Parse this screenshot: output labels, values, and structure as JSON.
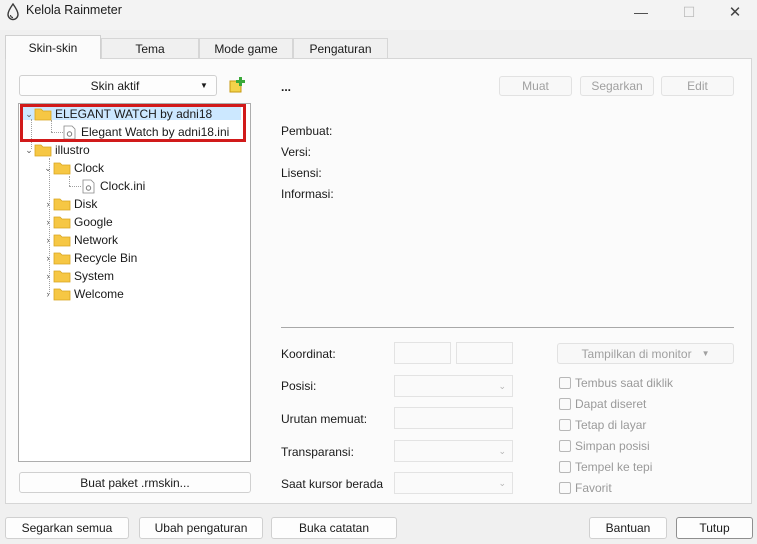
{
  "window": {
    "title": "Kelola Rainmeter",
    "icon": "rainmeter-drop-icon",
    "controls": [
      "minimize-icon",
      "maximize-icon",
      "close-icon"
    ]
  },
  "tabs": [
    {
      "label": "Skin-skin",
      "active": true
    },
    {
      "label": "Tema",
      "active": false
    },
    {
      "label": "Mode game",
      "active": false
    },
    {
      "label": "Pengaturan",
      "active": false
    }
  ],
  "skins_panel": {
    "dropdown_value": "Skin aktif",
    "add_icon": "add-skin-icon",
    "tree": [
      {
        "label": "ELEGANT WATCH by adni18",
        "type": "folder",
        "expanded": true,
        "selected": true
      },
      {
        "label": "Elegant Watch by adni18.ini",
        "type": "file"
      },
      {
        "label": "illustro",
        "type": "folder",
        "expanded": true
      },
      {
        "label": "Clock",
        "type": "folder",
        "expanded": true
      },
      {
        "label": "Clock.ini",
        "type": "file"
      },
      {
        "label": "Disk",
        "type": "folder",
        "expanded": false
      },
      {
        "label": "Google",
        "type": "folder",
        "expanded": false
      },
      {
        "label": "Network",
        "type": "folder",
        "expanded": false
      },
      {
        "label": "Recycle Bin",
        "type": "folder",
        "expanded": false
      },
      {
        "label": "System",
        "type": "folder",
        "expanded": false
      },
      {
        "label": "Welcome",
        "type": "folder",
        "expanded": false
      }
    ],
    "create_package_label": "Buat paket .rmskin..."
  },
  "details": {
    "skin_name": "...",
    "buttons": {
      "load": "Muat",
      "refresh": "Segarkan",
      "edit": "Edit"
    },
    "labels": {
      "author": "Pembuat:",
      "version": "Versi:",
      "license": "Lisensi:",
      "information": "Informasi:"
    }
  },
  "settings": {
    "labels": {
      "coordinates": "Koordinat:",
      "position": "Posisi:",
      "load_order": "Urutan memuat:",
      "transparency": "Transparansi:",
      "on_hover": "Saat kursor berada"
    },
    "monitor_button": "Tampilkan di monitor",
    "checkboxes": [
      {
        "label": "Tembus saat diklik",
        "checked": false
      },
      {
        "label": "Dapat diseret",
        "checked": false
      },
      {
        "label": "Tetap di layar",
        "checked": false
      },
      {
        "label": "Simpan posisi",
        "checked": false
      },
      {
        "label": "Tempel ke tepi",
        "checked": false
      },
      {
        "label": "Favorit",
        "checked": false
      }
    ]
  },
  "footer": {
    "refresh_all": "Segarkan semua",
    "edit_settings": "Ubah pengaturan",
    "open_log": "Buka catatan",
    "help": "Bantuan",
    "close": "Tutup"
  },
  "colors": {
    "selection": "#cce8ff",
    "annotation_box": "#d11a1a",
    "folder": "#f6c744"
  }
}
